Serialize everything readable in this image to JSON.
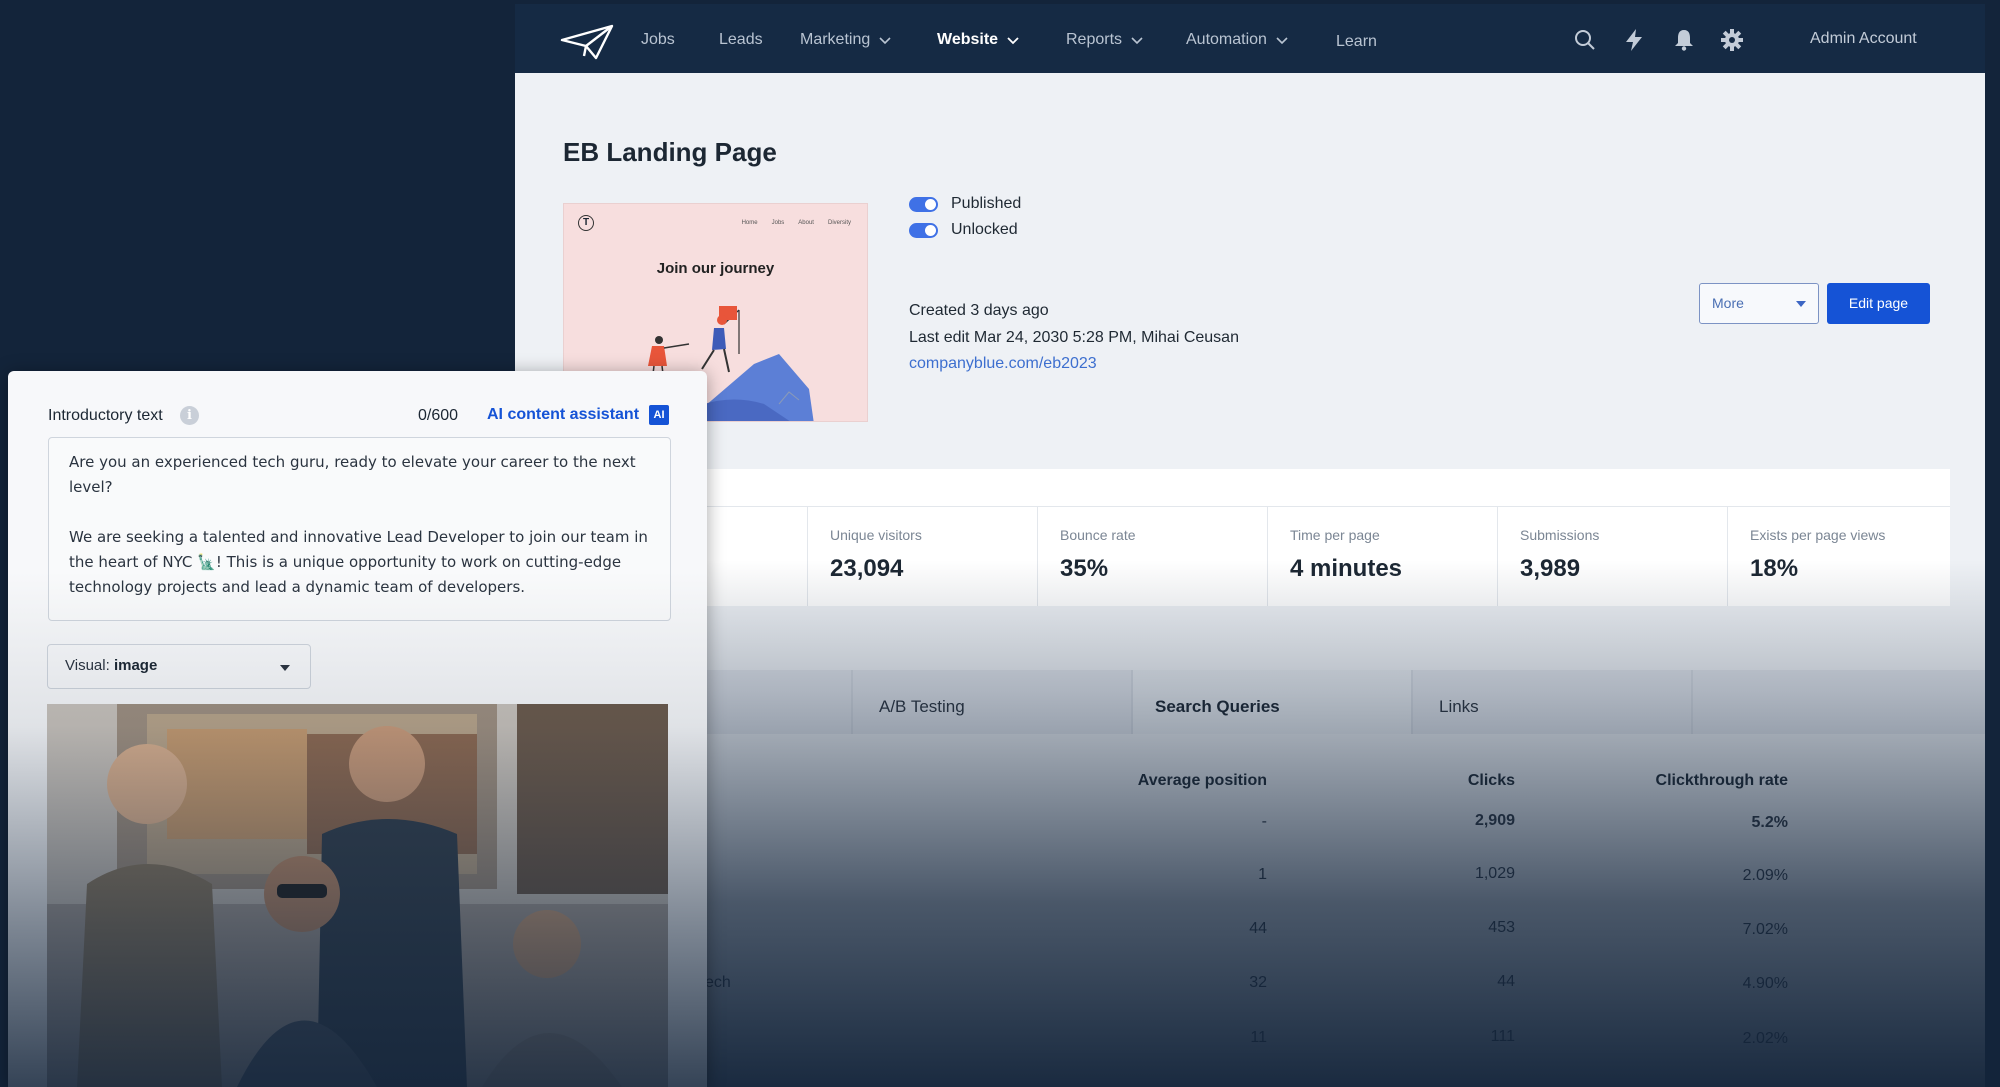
{
  "nav": {
    "items": [
      {
        "label": "Jobs",
        "dropdown": false
      },
      {
        "label": "Leads",
        "dropdown": false
      },
      {
        "label": "Marketing",
        "dropdown": true
      },
      {
        "label": "Website",
        "dropdown": true,
        "active": true
      },
      {
        "label": "Reports",
        "dropdown": true
      },
      {
        "label": "Automation",
        "dropdown": true
      },
      {
        "label": "Learn",
        "dropdown": false
      }
    ],
    "icons": [
      "search-icon",
      "bolt-icon",
      "bell-icon",
      "gear-icon"
    ],
    "account": "Admin Account"
  },
  "page": {
    "title": "EB Landing Page",
    "thumbnail": {
      "logo": "T",
      "nav": [
        "Home",
        "Jobs",
        "About",
        "Diversity"
      ],
      "heading": "Join our journey"
    },
    "status": {
      "published": "Published",
      "unlocked": "Unlocked",
      "created": "Created 3 days ago",
      "last_edit": "Last edit Mar 24, 2030 5:28 PM, Mihai Ceusan",
      "url": "companyblue.com/eb2023"
    },
    "actions": {
      "more": "More",
      "edit": "Edit page"
    }
  },
  "stats": [
    {
      "label": "Unique visitors",
      "value": "23,094"
    },
    {
      "label": "Bounce rate",
      "value": "35%"
    },
    {
      "label": "Time per page",
      "value": "4 minutes"
    },
    {
      "label": "Submissions",
      "value": "3,989"
    },
    {
      "label": "Exists per page views",
      "value": "18%"
    }
  ],
  "tabs": [
    {
      "label": "A/B Testing"
    },
    {
      "label": "Search Queries",
      "active": true
    },
    {
      "label": "Links"
    }
  ],
  "table": {
    "headers": {
      "position": "Average position",
      "clicks": "Clicks",
      "ctr": "Clickthrough rate"
    },
    "rows": [
      {
        "query": "",
        "position": "-",
        "clicks": "2,909",
        "ctr": "5.2%"
      },
      {
        "query": "",
        "position": "1",
        "clicks": "1,029",
        "ctr": "2.09%"
      },
      {
        "query": "",
        "position": "44",
        "clicks": "453",
        "ctr": "7.02%"
      },
      {
        "query": "ech",
        "position": "32",
        "clicks": "44",
        "ctr": "4.90%"
      },
      {
        "query": "",
        "position": "11",
        "clicks": "111",
        "ctr": "2.02%"
      }
    ]
  },
  "panel": {
    "label": "Introductory text",
    "counter": "0/600",
    "ai_label": "AI content assistant",
    "ai_badge": "AI",
    "text": "Are you an experienced tech guru, ready to elevate your career to the next level?\n\nWe are seeking a talented and innovative Lead Developer to join our team in the heart of NYC 🗽! This is a unique opportunity to work on cutting-edge technology projects and lead a dynamic team of developers.",
    "visual_prefix": "Visual:",
    "visual_value": "image"
  },
  "colors": {
    "topbar": "#152a44",
    "accent": "#1553d6",
    "toggle": "#3f71e6",
    "background": "#13243a"
  }
}
